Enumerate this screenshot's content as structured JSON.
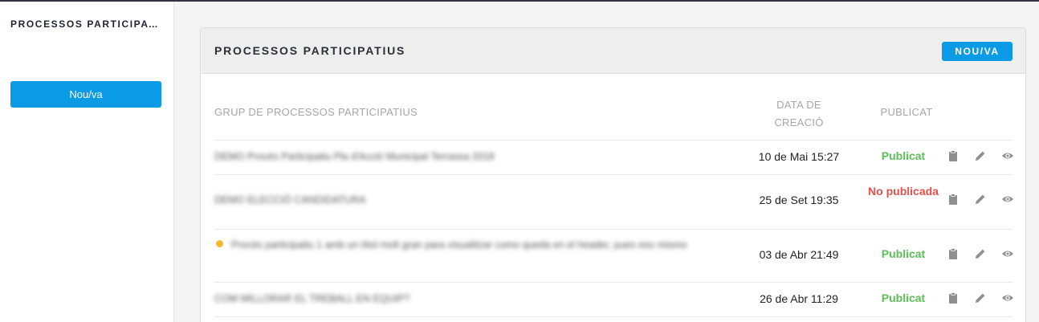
{
  "sidebar": {
    "title": "PROCESSOS PARTICIPATIUS",
    "new_button": "Nou/va"
  },
  "card": {
    "title": "PROCESSOS PARTICIPATIUS",
    "new_button": "NOU/VA"
  },
  "table": {
    "headers": {
      "name": "GRUP DE PROCESSOS PARTICIPATIUS",
      "date": "DATA DE CREACIÓ",
      "published": "PUBLICAT"
    },
    "rows": [
      {
        "name": "DEMO Procés Participatiu Pla d'Acció Municipal Terrassa 2018",
        "date": "10 de Mai 15:27",
        "status": "Publicat",
        "highlighted": false
      },
      {
        "name": "DEMO ELECCIÓ CANDIDATURA",
        "date": "25 de Set 19:35",
        "status": "No publicada",
        "highlighted": false
      },
      {
        "name": "Procés participatiu 1 amb un títol molt gran para visualitzar como queda en el header, pues eso mismo",
        "date": "03 de Abr 21:49",
        "status": "Publicat",
        "highlighted": true
      },
      {
        "name": "COM MILLORAR EL TREBALL EN EQUIP?",
        "date": "26 de Abr 11:29",
        "status": "Publicat",
        "highlighted": false
      }
    ]
  },
  "icons": {
    "copy": "clipboard-icon",
    "edit": "pencil-icon",
    "view": "eye-icon"
  },
  "colors": {
    "accent": "#0b9ae6",
    "published": "#5bbf56",
    "unpublished": "#e2504a",
    "highlight_dot": "#f5b82e"
  }
}
